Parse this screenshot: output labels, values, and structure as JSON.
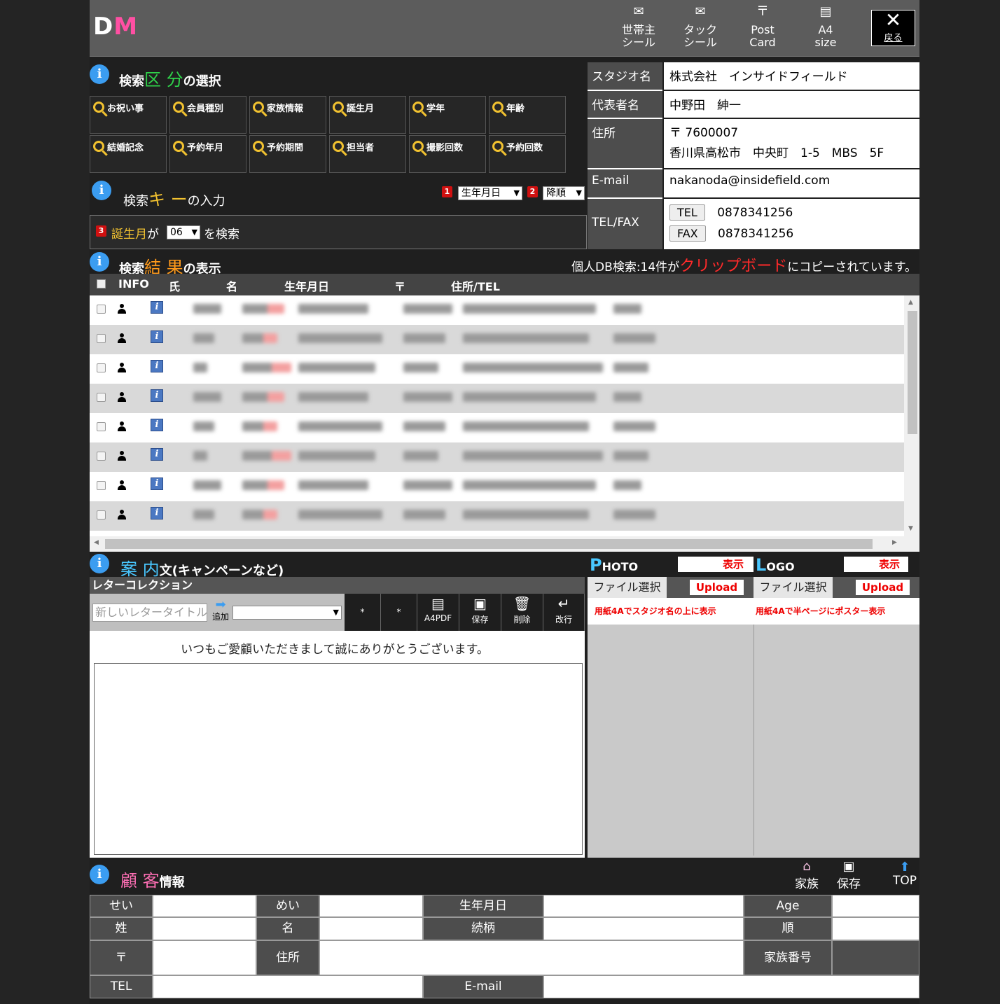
{
  "header": {
    "logo_d": "D",
    "logo_m": "M",
    "buttons": [
      {
        "icon": "✉",
        "label1": "世帯主",
        "label2": "シール"
      },
      {
        "icon": "✉",
        "label1": "タック",
        "label2": "シール"
      },
      {
        "icon": "〒",
        "label1": "Post",
        "label2": "Card"
      },
      {
        "icon": "▤",
        "label1": "A4",
        "label2": "size"
      }
    ],
    "close_label": "戻る",
    "close_icon": "✕"
  },
  "search_section": {
    "title_pre": "検索",
    "title_hl": "区 分",
    "title_post": "の選択",
    "buttons": [
      "お祝い事",
      "会員種別",
      "家族情報",
      "誕生月",
      "学年",
      "年齢",
      "結婚記念",
      "予約年月",
      "予約期間",
      "担当者",
      "撮影回数",
      "予約回数"
    ]
  },
  "key_section": {
    "title_pre": "検索",
    "title_hl": "キ ー",
    "title_post": "の入力",
    "num1": "1",
    "sort1": "生年月日",
    "num2": "2",
    "sort2": "降順",
    "num3": "3",
    "cond_field": "誕生月",
    "cond_ga": "が",
    "cond_value": "06",
    "cond_post": "を検索"
  },
  "studio": {
    "name_label": "スタジオ名",
    "name": "株式会社　インサイドフィールド",
    "rep_label": "代表者名",
    "rep": "中野田　紳一",
    "addr_label": "住所",
    "zip": "〒 7600007",
    "addr": "香川県高松市　中央町　1-5　MBS　5F",
    "email_label": "E-mail",
    "email": "nakanoda@insidefield.com",
    "telfax_label": "TEL/FAX",
    "tel_tag": "TEL",
    "tel": "0878341256",
    "fax_tag": "FAX",
    "fax": "0878341256"
  },
  "results": {
    "title_pre": "検索",
    "title_hl": "結 果",
    "title_post": "の表示",
    "msg_pre": "個人DB検索:14件が",
    "msg_hl": "クリップボード",
    "msg_post": "にコピーされています。",
    "columns": [
      "INFO",
      "氏",
      "名",
      "生年月日",
      "〒",
      "住所/TEL"
    ],
    "row_info_icon": "i"
  },
  "letter": {
    "title_hl": "案 内",
    "title_post": "文(キャンペーンなど)",
    "collection_label": "レターコレクション",
    "title_placeholder": "新しいレタータイトル",
    "add_label": "追加",
    "star1": "*",
    "star2": "*",
    "pdf_label": "A4PDF",
    "save_label": "保存",
    "delete_label": "削除",
    "newline_label": "改行",
    "greeting": "いつもご愛顧いただきまして誠にありがとうございます。"
  },
  "photo": {
    "title_big": "P",
    "title_rest": "HOTO",
    "show_label": "表示",
    "file_label": "ファイル選択",
    "upload_label": "Upload",
    "note": "用紙4Aでスタジオ名の上に表示"
  },
  "logo_panel": {
    "title_big": "L",
    "title_rest": "OGO",
    "show_label": "表示",
    "file_label": "ファイル選択",
    "upload_label": "Upload",
    "note": "用紙4Aで半ページにポスター表示"
  },
  "customer": {
    "title_hl": "顧 客",
    "title_post": "情報",
    "family_label": "家族",
    "save_label": "保存",
    "top_label": "TOP",
    "sei": "せい",
    "mei": "めい",
    "birth": "生年月日",
    "age": "Age",
    "last": "姓",
    "first": "名",
    "relation": "続柄",
    "order": "順",
    "zip": "〒",
    "address": "住所",
    "family_no": "家族番号",
    "tel": "TEL",
    "email": "E-mail"
  },
  "colors": {
    "accent_green": "#2fd34a",
    "accent_yellow": "#f2c230",
    "accent_orange": "#ff9a1a",
    "accent_pink": "#ff6fb5",
    "accent_cyan": "#49c7ff",
    "accent_red": "#ff2a2a"
  }
}
